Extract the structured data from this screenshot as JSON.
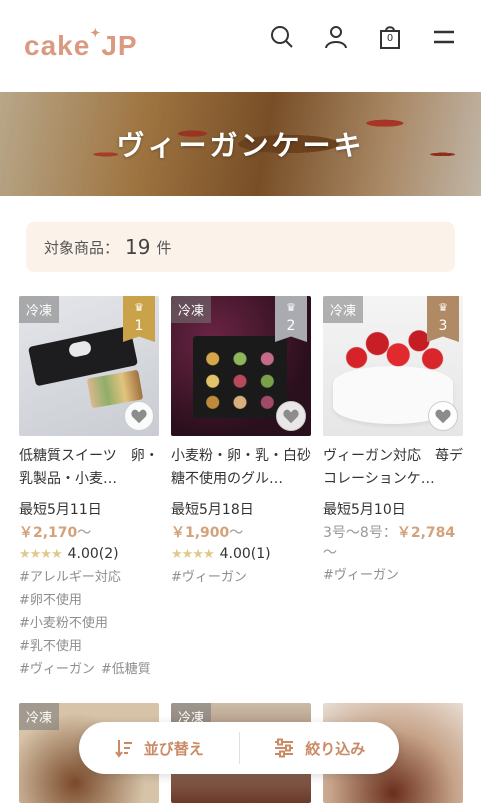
{
  "header": {
    "logo_text": "cake",
    "logo_suffix": "JP",
    "icons": [
      "search-icon",
      "user-icon",
      "bag-icon",
      "menu-icon"
    ],
    "cart_count": "0"
  },
  "banner": {
    "title": "ヴィーガンケーキ"
  },
  "count": {
    "label": "対象商品：",
    "value": "19",
    "unit": "件"
  },
  "products": [
    {
      "frozen": "冷凍",
      "rank": "1",
      "name": "低糖質スイーツ　卵・乳製品・小麦…",
      "date": "最短5月11日",
      "price": "￥2,170",
      "price_suffix": "～",
      "stars": "★★★★",
      "rating": "4.00(2)",
      "tags": [
        "#アレルギー対応",
        "#卵不使用",
        "#小麦粉不使用",
        "#乳不使用",
        "#ヴィーガン",
        "#低糖質"
      ]
    },
    {
      "frozen": "冷凍",
      "rank": "2",
      "name": "小麦粉・卵・乳・白砂糖不使用のグル…",
      "date": "最短5月18日",
      "price": "￥1,900",
      "price_suffix": "～",
      "stars": "★★★★",
      "rating": "4.00(1)",
      "tags": [
        "#ヴィーガン"
      ]
    },
    {
      "frozen": "冷凍",
      "rank": "3",
      "name": "ヴィーガン対応　苺デコレーションケ…",
      "date": "最短5月10日",
      "size": "3号～8号：",
      "price": "￥2,784",
      "price_suffix": "～",
      "tags": [
        "#ヴィーガン"
      ]
    }
  ],
  "row2": [
    {
      "frozen": "冷凍"
    },
    {
      "frozen": "冷凍"
    },
    {
      "frozen": ""
    }
  ],
  "actions": {
    "sort_label": "並び替え",
    "filter_label": "絞り込み"
  },
  "colors": {
    "accent": "#d4a27a",
    "gold": "#c9a24a",
    "silver": "#a9abb0",
    "bronze": "#b08a64"
  }
}
